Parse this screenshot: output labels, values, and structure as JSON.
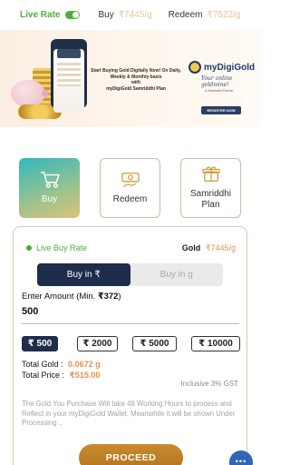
{
  "ratebar": {
    "live_label": "Live Rate",
    "buy_label": "Buy",
    "buy_value": "₹7445/g",
    "redeem_label": "Redeem",
    "redeem_value": "₹7522/g"
  },
  "banner": {
    "headline": "Start Buying Gold Digitally Now! On Daily, Weekly & Monthly basis",
    "with": "with",
    "plan": "myDigiGold Samriddhi Plan",
    "logo": "myDigiGold",
    "tagline": "Your online goldmine!",
    "partner": "& Samriddhi Partner",
    "cta": "REGISTER NOW"
  },
  "tiles": [
    {
      "label": "Buy",
      "icon": "cart-icon"
    },
    {
      "label": "Redeem",
      "icon": "redeem-icon"
    },
    {
      "label": "Samriddhi Plan",
      "icon": "gift-icon"
    }
  ],
  "card": {
    "live_buy_label": "Live Buy Rate",
    "gold_label": "Gold",
    "gold_rate": "₹7445/g",
    "segment": {
      "rupee": "Buy in ₹",
      "gram": "Buy in g",
      "selected": "rupee"
    },
    "amount_label": "Enter Amount (Min. ",
    "amount_min": "₹372",
    "amount_label_end": ")",
    "amount_value": "500",
    "chips": [
      "₹ 500",
      "₹ 2000",
      "₹ 5000",
      "₹ 10000"
    ],
    "total_gold_label": "Total Gold :",
    "total_gold_value": "0.0672 g",
    "total_price_label": "Total Price :",
    "total_price_value": "₹515.00",
    "gst_note": "Inclusive 3% GST",
    "info": "The Gold You Purchase Will take 48 Working Hours to process and Reflect in your myDigiGold Wallet, Meanwhile it will be shown Under Processing ..",
    "proceed": "PROCEED"
  },
  "colors": {
    "live_green": "#4caf3a",
    "navy": "#1f2d4d",
    "gold_accent": "#e0954c",
    "proceed": "#c08126",
    "chat": "#2f66b5"
  }
}
